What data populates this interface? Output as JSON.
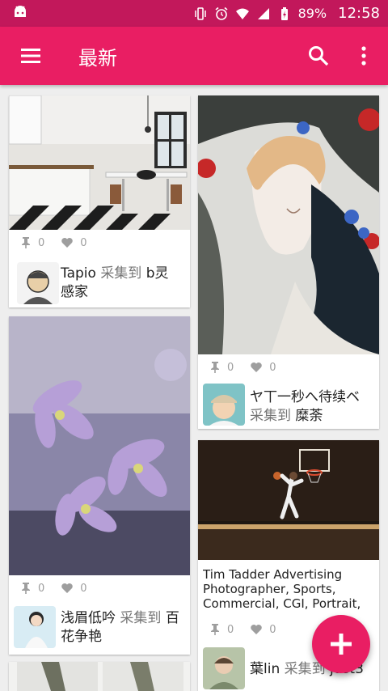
{
  "status_bar": {
    "battery": "89%",
    "time": "12:58"
  },
  "app_bar": {
    "title": "最新"
  },
  "cards": [
    {
      "pins": "0",
      "likes": "0",
      "user": "Tapio",
      "action": "采集到",
      "board": "b灵感家"
    },
    {
      "pins": "0",
      "likes": "0",
      "user": "ヤ丅一秒へ待续ベ",
      "action": "采集到",
      "board": "糜荼"
    },
    {
      "pins": "0",
      "likes": "0",
      "user": "浅眉低吟",
      "action": "采集到",
      "board": "百花争艳"
    },
    {
      "pins": "0",
      "likes": "0",
      "user": "葉lin",
      "action": "采集到",
      "board": "just3",
      "description": "Tim Tadder Advertising Photographer, Sports, Commercial, CGI, Portrait,"
    }
  ]
}
